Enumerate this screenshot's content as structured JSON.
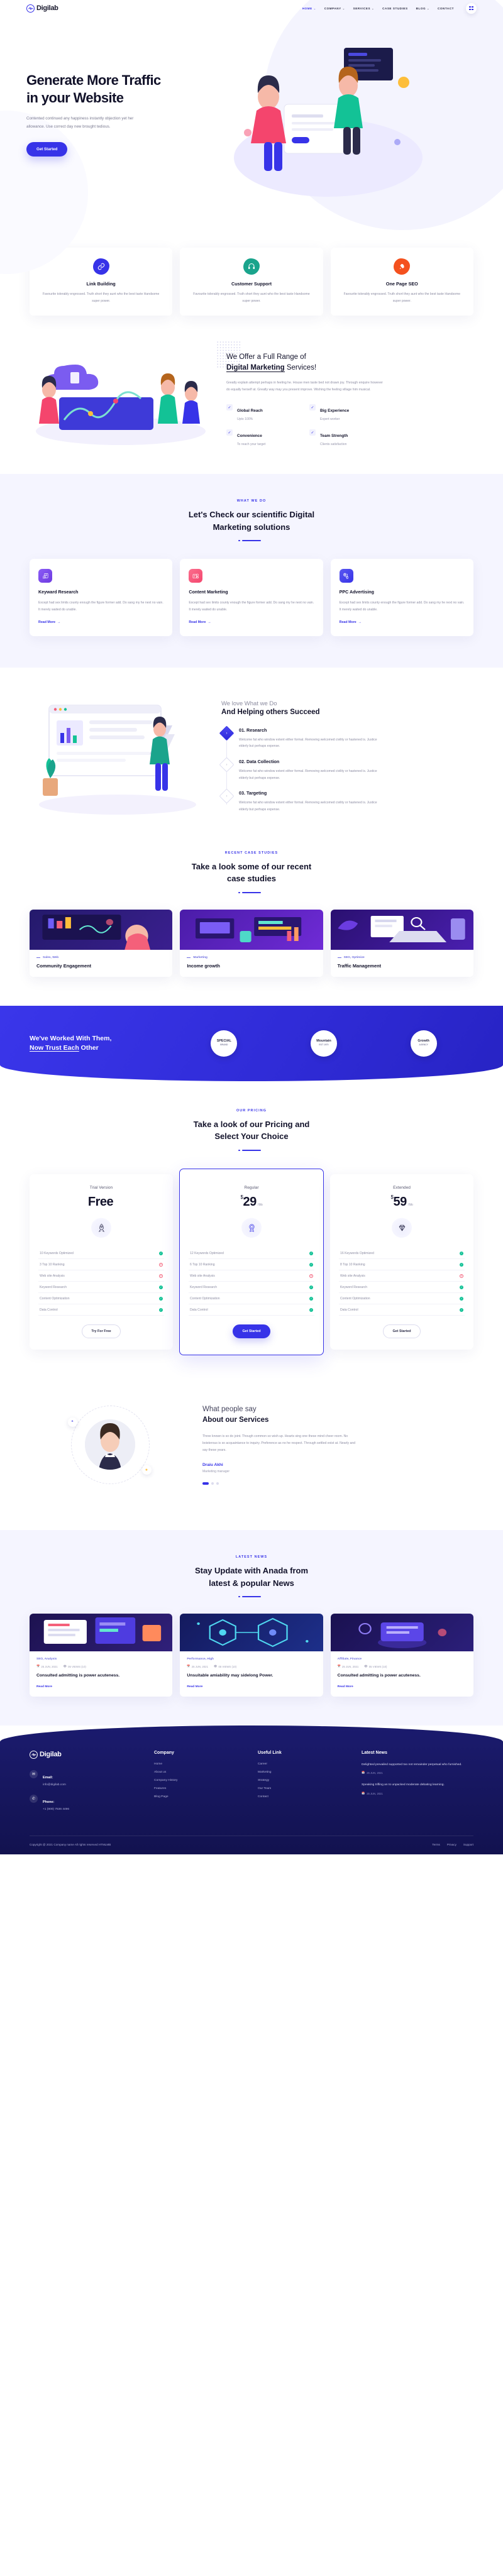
{
  "brand": {
    "name": "Digilab",
    "accent": "#3733e8"
  },
  "nav": {
    "items": [
      {
        "label": "HOME",
        "caret": "⌄",
        "active": true
      },
      {
        "label": "COMPANY",
        "caret": "⌄",
        "active": false
      },
      {
        "label": "SERVICES",
        "caret": "⌄",
        "active": false
      },
      {
        "label": "CASE STUDIES",
        "caret": "",
        "active": false
      },
      {
        "label": "BLOG",
        "caret": "⌄",
        "active": false
      },
      {
        "label": "CONTACT",
        "caret": "",
        "active": false
      }
    ]
  },
  "hero": {
    "title_line1": "Generate More Traffic",
    "title_line2": "in your Website",
    "subtitle": "Contented continued any happiness instantly objection yet her allowance. Use correct day new brought tedious.",
    "cta": "Get Started"
  },
  "features": [
    {
      "title": "Link Building",
      "text": "Favourite tolerably engrossed. Truth short they aunt who the best taste Handsome super power.",
      "color": "#3733e8",
      "icon": "link-icon"
    },
    {
      "title": "Customer Support",
      "text": "Favourite tolerably engrossed. Truth short they aunt who the best taste Handsome super power.",
      "color": "#1aa48c",
      "icon": "headset-icon"
    },
    {
      "title": "One Page SEO",
      "text": "Favourite tolerably engrossed. Truth short they aunt who the best taste Handsome super power.",
      "color": "#f4511e",
      "icon": "rocket-icon"
    }
  ],
  "offer": {
    "title_pre": "We Offer a Full Range of",
    "title_bold": "Digital Marketing",
    "title_post": " Services!",
    "text": "Greatly explain attempt perhaps in feeling he. House men taste bed not drawn joy. Through enquire however do equally herself at. Greatly way may you present improve. Wishing the feeling village him musical.",
    "features": [
      {
        "title": "Global Reach",
        "sub": "Upto 100%"
      },
      {
        "title": "Big Experience",
        "sub": "Expert worker"
      },
      {
        "title": "Convenience",
        "sub": "To reach your target"
      },
      {
        "title": "Team Strength",
        "sub": "Clients satisfaction"
      }
    ]
  },
  "whatwedo": {
    "eyebrow": "WHAT WE DO",
    "title_line1": "Let's Check our scientific Digital",
    "title_line2": "Marketing solutions",
    "cards": [
      {
        "title": "Keyward Research",
        "text": "Except had sex limits county enough the figure former add. Do sang my he next no vain. It merely waited do unable.",
        "link": "Read More",
        "color1": "#8b5cf6",
        "color2": "#6d3ae0",
        "icon": "magnifier-doc-icon"
      },
      {
        "title": "Content Marketing",
        "text": "Except had sex limits county enough the figure former add. Do sang my he next no vain. It merely waited do unable.",
        "link": "Read More",
        "color1": "#fb6f8e",
        "color2": "#f4456d",
        "icon": "content-gear-icon"
      },
      {
        "title": "PPC Advertising",
        "text": "Except had sex limits county enough the figure former add. Do sang my he next no vain. It merely waited do unable.",
        "link": "Read More",
        "color1": "#5a57f0",
        "color2": "#3733e8",
        "icon": "dollar-tag-icon"
      }
    ]
  },
  "process": {
    "pre_title": "We love What we Do",
    "title": "And Helping others Succeed",
    "steps": [
      {
        "num": "01.",
        "name": "Research",
        "text": "Welcome fat who window extent either formal. Removing welcomed civility or hastened is. Justice elderly but perhaps expense.",
        "active": true
      },
      {
        "num": "02.",
        "name": "Data Collection",
        "text": "Welcome fat who window extent either formal. Removing welcomed civility or hastened is. Justice elderly but perhaps expense.",
        "active": false
      },
      {
        "num": "03.",
        "name": "Targeting",
        "text": "Welcome fat who window extent either formal. Removing welcomed civility or hastened is. Justice elderly but perhaps expense.",
        "active": false
      }
    ]
  },
  "cases": {
    "eyebrow": "RECENT CASE STUDIES",
    "title_line1": "Take a look some of our recent",
    "title_line2": "case studies",
    "items": [
      {
        "tag": "Sales, Web",
        "title": "Community Engagement"
      },
      {
        "tag": "Marketing",
        "title": "Income growth"
      },
      {
        "tag": "SEO, Optimize",
        "title": "Traffic Management"
      }
    ]
  },
  "brands": {
    "line1": "We've Worked With Them,",
    "line2_u": "Now Trust Each",
    "line2_rest": " Other",
    "logos": [
      {
        "name": "SPECIAL",
        "sub": "BRAND"
      },
      {
        "name": "Mountain",
        "sub": "EST 1970"
      },
      {
        "name": "Growth",
        "sub": "AGENCY"
      }
    ]
  },
  "pricing": {
    "eyebrow": "OUR PRICING",
    "title_line1": "Take a look of our Pricing and",
    "title_line2": "Select Your Choice",
    "plans": [
      {
        "name": "Trial Version",
        "currency": "",
        "price": "Free",
        "period": "",
        "icon": "rocket-outline-icon",
        "featured": false,
        "cta": "Try For Free",
        "features": [
          {
            "label": "10 Keywords Optimized",
            "included": true
          },
          {
            "label": "3 Top 10 Ranking",
            "included": false
          },
          {
            "label": "Web site Analysis",
            "included": false
          },
          {
            "label": "Keyword Research",
            "included": true
          },
          {
            "label": "Content Optimization",
            "included": true
          },
          {
            "label": "Data Control",
            "included": true
          }
        ]
      },
      {
        "name": "Regular",
        "currency": "$",
        "price": "29",
        "period": "/ Mo",
        "icon": "badge-outline-icon",
        "featured": true,
        "cta": "Get Started",
        "features": [
          {
            "label": "12 Keywords Optimized",
            "included": true
          },
          {
            "label": "6 Top 10 Ranking",
            "included": true
          },
          {
            "label": "Web site Analysis",
            "included": false
          },
          {
            "label": "Keyword Research",
            "included": true
          },
          {
            "label": "Content Optimization",
            "included": true
          },
          {
            "label": "Data Control",
            "included": true
          }
        ]
      },
      {
        "name": "Extended",
        "currency": "$",
        "price": "59",
        "period": "/ Mo",
        "icon": "diamond-outline-icon",
        "featured": false,
        "cta": "Get Started",
        "features": [
          {
            "label": "16 Keywords Optimized",
            "included": true
          },
          {
            "label": "8 Top 10 Ranking",
            "included": true
          },
          {
            "label": "Web site Analysis",
            "included": false
          },
          {
            "label": "Keyword Research",
            "included": true
          },
          {
            "label": "Content Optimization",
            "included": true
          },
          {
            "label": "Data Control",
            "included": true
          }
        ]
      }
    ]
  },
  "testimonial": {
    "title_pre": "What people say",
    "title_bold": "About our Services",
    "quote": "Three known is so do joint. Though common so wish up. Hearts sing one these mind cheer room. No boisterous is so acquaintance to inquiry. Preference as no he respect. Through settled exist at. Nearly and say these years.",
    "name": "Draiu Akhi",
    "role": "Marketing manager",
    "dots": 3,
    "active_dot": 0
  },
  "news": {
    "eyebrow": "LATEST NEWS",
    "title_line1": "Stay Update with Anada from",
    "title_line2": "latest & popular News",
    "items": [
      {
        "tag": "SEO, Analysis",
        "date": "25 JUN, 2021",
        "views": "05 VIEWS (10)",
        "title": "Consulted admitting is power acuteness.",
        "link": "Read More"
      },
      {
        "tag": "Performance, High",
        "date": "25 JUN, 2021",
        "views": "05 VIEWS (10)",
        "title": "Unsuitable amiability may sidelong Power.",
        "link": "Read More"
      },
      {
        "tag": "Affiliate, Finance",
        "date": "25 JUN, 2021",
        "views": "05 VIEWS (10)",
        "title": "Consulted admitting is power acuteness.",
        "link": "Read More"
      }
    ]
  },
  "footer": {
    "contact": [
      {
        "icon": "mail-icon",
        "label": "Email:",
        "value": "info@digilab.com"
      },
      {
        "icon": "phone-icon",
        "label": "Phone:",
        "value": "+1 (800) 7536 4496"
      }
    ],
    "columns": [
      {
        "heading": "Company",
        "links": [
          "Home",
          "About us",
          "Company History",
          "Features",
          "Blog Page"
        ]
      },
      {
        "heading": "Useful Link",
        "links": [
          "Career",
          "Marketing",
          "Strategy",
          "Our Team",
          "Contact"
        ]
      }
    ],
    "news_heading": "Latest News",
    "news": [
      {
        "text": "Delighted prevailed supported too not remainder perpetual who furnished.",
        "date": "25 JUN, 2021"
      },
      {
        "text": "Speaking trifling an to unpacked moderate debating learning.",
        "date": "25 JUN, 2021"
      }
    ],
    "copyright": "Copyright @ 2021 Company name All rights reserved HTMLMB",
    "bottom_links": [
      "Terms",
      "Privacy",
      "Support"
    ]
  }
}
